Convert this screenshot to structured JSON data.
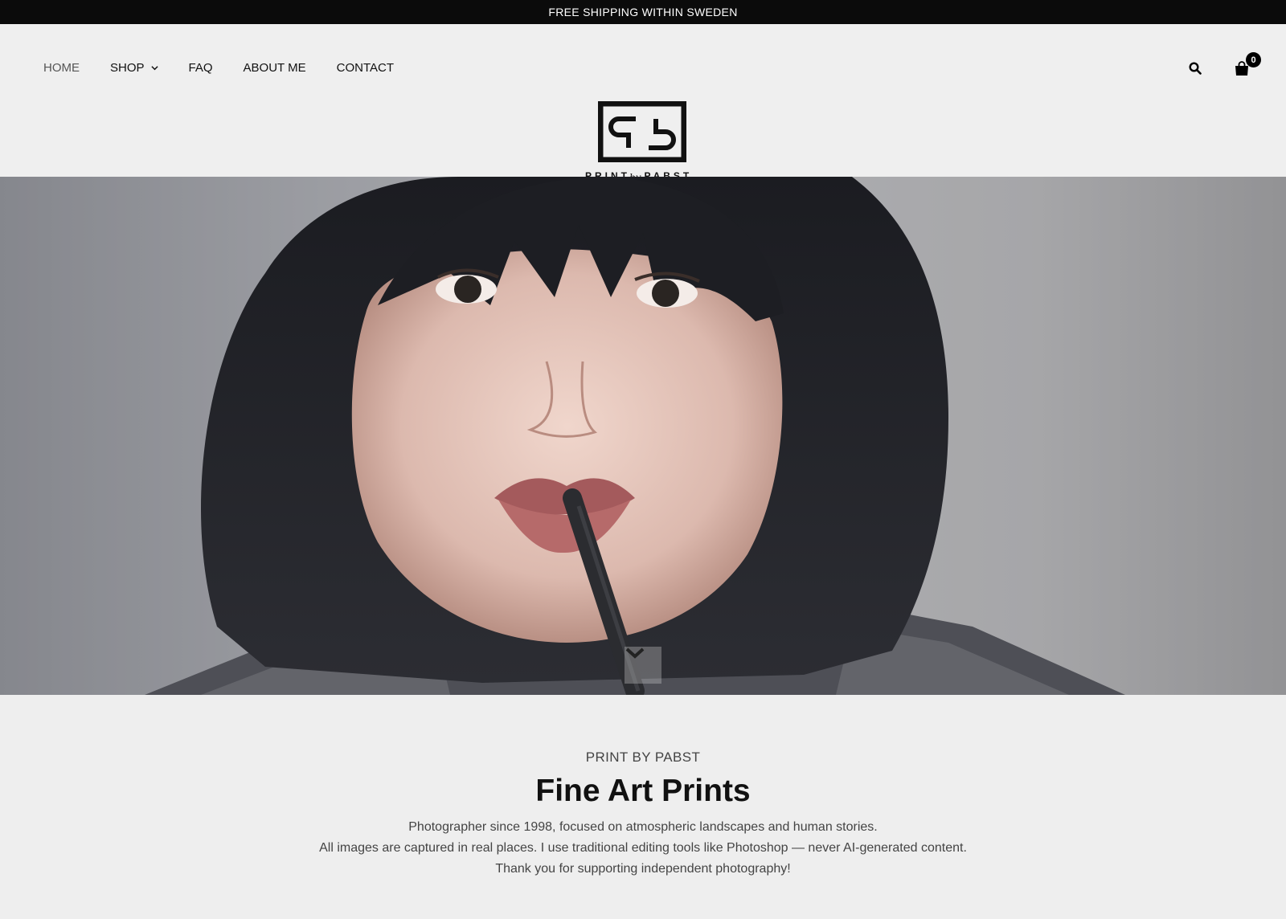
{
  "announcement": {
    "text": "FREE SHIPPING WITHIN SWEDEN"
  },
  "nav": {
    "items": [
      {
        "label": "HOME"
      },
      {
        "label": "SHOP"
      },
      {
        "label": "FAQ"
      },
      {
        "label": "ABOUT ME"
      },
      {
        "label": "CONTACT"
      }
    ]
  },
  "header": {
    "cart_count": "0",
    "logo": {
      "left": "PRINT",
      "by": "by",
      "right": "PABST"
    }
  },
  "icons": {
    "search": "search-icon",
    "cart": "shopping-bag-icon",
    "scroll": "chevron-down-icon"
  },
  "intro": {
    "eyebrow": "PRINT BY PABST",
    "title": "Fine Art Prints",
    "lines": [
      "Photographer since 1998, focused on atmospheric landscapes and human stories.",
      "All images are captured in real places. I use traditional editing tools like Photoshop — never AI-generated content.",
      "Thank you for supporting independent photography!"
    ]
  },
  "colors": {
    "topbar": "#0b0b0b",
    "background": "#eeeeee",
    "text": "#111111",
    "muted": "#444444"
  }
}
